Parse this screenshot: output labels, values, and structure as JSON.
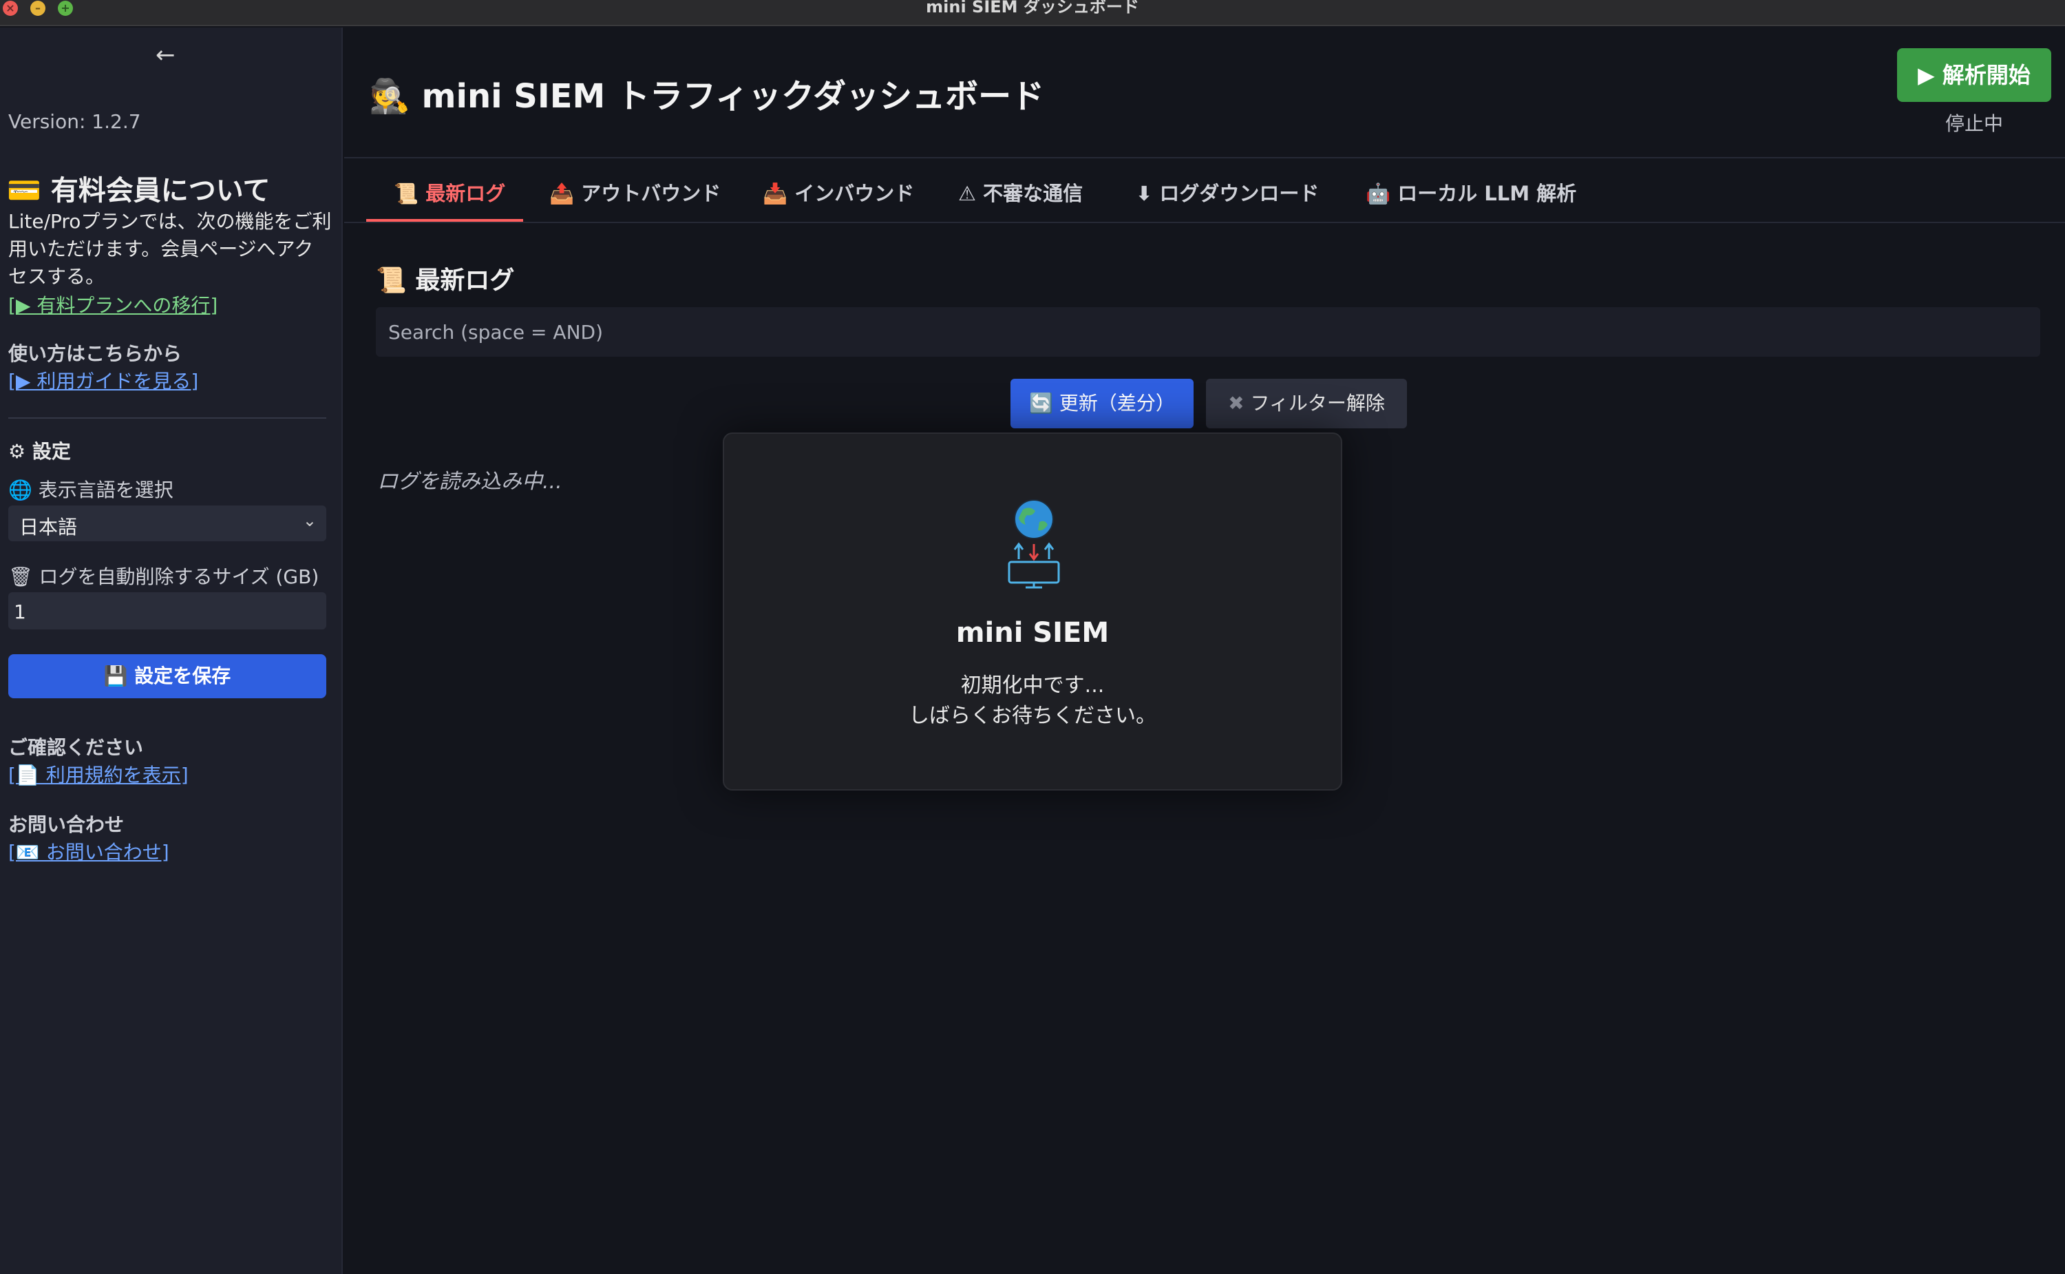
{
  "window": {
    "title": "mini SIEM ダッシュボード"
  },
  "sidebar": {
    "back_icon": "←",
    "version": "Version: 1.2.7",
    "plan_title": "💳 有料会員について",
    "plan_desc": "Lite/Proプランでは、次の機能をご利用いただけます。会員ページへアクセスする。",
    "plan_link": "[▶ 有料プランへの移行]",
    "guide_title": "使い方はこちらから",
    "guide_link": "[▶ 利用ガイドを見る]",
    "settings_title": "⚙ 設定",
    "lang_label": "🌐 表示言語を選択",
    "lang_value": "日本語",
    "size_label": "🗑 ログを自動削除するサイズ (GB)",
    "size_value": "1",
    "save_label": "💾 設定を保存",
    "confirm_title": "ご確認ください",
    "terms_link": "[📄 利用規約を表示]",
    "contact_title": "お問い合わせ",
    "contact_link": "[📧 お問い合わせ]"
  },
  "header": {
    "title": "🕵 mini SIEM トラフィックダッシュボード",
    "start_label": "▶ 解析開始",
    "status": "停止中"
  },
  "tabs": [
    {
      "label": "📜 最新ログ"
    },
    {
      "label": "📤 アウトバウンド"
    },
    {
      "label": "📥 インバウンド"
    },
    {
      "label": "⚠ 不審な通信"
    },
    {
      "label": "⬇ ログダウンロード"
    },
    {
      "label": "🤖 ローカル LLM 解析"
    }
  ],
  "content": {
    "section_title": "📜 最新ログ",
    "search_placeholder": "Search (space = AND)",
    "refresh_label": "🔄 更新（差分）",
    "clear_label": "フィルター解除",
    "loading": "ログを読み込み中..."
  },
  "modal": {
    "title": "mini SIEM",
    "line1": "初期化中です...",
    "line2": "しばらくお待ちください。"
  },
  "colors": {
    "accent_blue": "#2f5fe0",
    "accent_green": "#3a9b45",
    "active_tab": "#ff6b6b",
    "link_blue": "#6ea3ff",
    "link_green": "#7fd88a"
  }
}
